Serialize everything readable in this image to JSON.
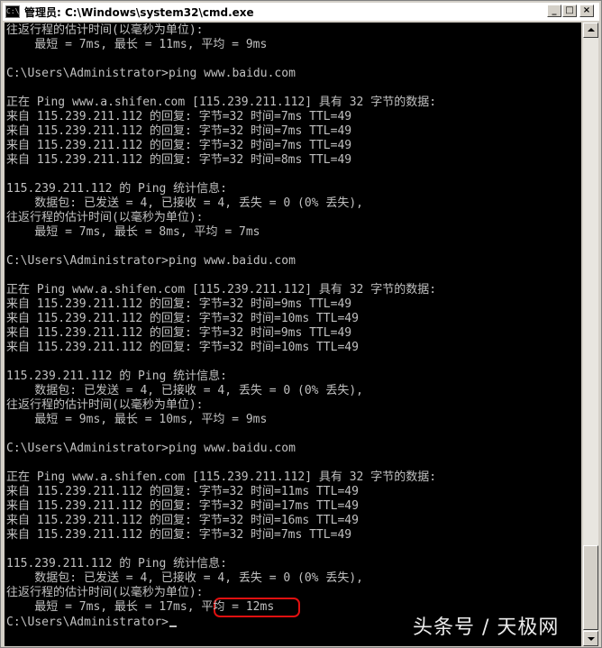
{
  "window": {
    "title": "管理员: C:\\Windows\\system32\\cmd.exe",
    "icon_label": "C:\\",
    "buttons": {
      "minimize": "_",
      "maximize": "□",
      "close": "×"
    }
  },
  "console": {
    "lines": [
      "往返行程的估计时间(以毫秒为单位):",
      "    最短 = 7ms, 最长 = 11ms, 平均 = 9ms",
      "",
      "C:\\Users\\Administrator>ping www.baidu.com",
      "",
      "正在 Ping www.a.shifen.com [115.239.211.112] 具有 32 字节的数据:",
      "来自 115.239.211.112 的回复: 字节=32 时间=7ms TTL=49",
      "来自 115.239.211.112 的回复: 字节=32 时间=7ms TTL=49",
      "来自 115.239.211.112 的回复: 字节=32 时间=7ms TTL=49",
      "来自 115.239.211.112 的回复: 字节=32 时间=8ms TTL=49",
      "",
      "115.239.211.112 的 Ping 统计信息:",
      "    数据包: 已发送 = 4, 已接收 = 4, 丢失 = 0 (0% 丢失),",
      "往返行程的估计时间(以毫秒为单位):",
      "    最短 = 7ms, 最长 = 8ms, 平均 = 7ms",
      "",
      "C:\\Users\\Administrator>ping www.baidu.com",
      "",
      "正在 Ping www.a.shifen.com [115.239.211.112] 具有 32 字节的数据:",
      "来自 115.239.211.112 的回复: 字节=32 时间=9ms TTL=49",
      "来自 115.239.211.112 的回复: 字节=32 时间=10ms TTL=49",
      "来自 115.239.211.112 的回复: 字节=32 时间=9ms TTL=49",
      "来自 115.239.211.112 的回复: 字节=32 时间=10ms TTL=49",
      "",
      "115.239.211.112 的 Ping 统计信息:",
      "    数据包: 已发送 = 4, 已接收 = 4, 丢失 = 0 (0% 丢失),",
      "往返行程的估计时间(以毫秒为单位):",
      "    最短 = 9ms, 最长 = 10ms, 平均 = 9ms",
      "",
      "C:\\Users\\Administrator>ping www.baidu.com",
      "",
      "正在 Ping www.a.shifen.com [115.239.211.112] 具有 32 字节的数据:",
      "来自 115.239.211.112 的回复: 字节=32 时间=11ms TTL=49",
      "来自 115.239.211.112 的回复: 字节=32 时间=17ms TTL=49",
      "来自 115.239.211.112 的回复: 字节=32 时间=16ms TTL=49",
      "来自 115.239.211.112 的回复: 字节=32 时间=7ms TTL=49",
      "",
      "115.239.211.112 的 Ping 统计信息:",
      "    数据包: 已发送 = 4, 已接收 = 4, 丢失 = 0 (0% 丢失),",
      "往返行程的估计时间(以毫秒为单位):",
      "    最短 = 7ms, 最长 = 17ms, 平均 = 12ms"
    ],
    "prompt": "C:\\Users\\Administrator>"
  },
  "watermark": "头条号 / 天极网",
  "colors": {
    "console_bg": "#000000",
    "console_text": "#c0c0c0",
    "highlight": "#e01010"
  }
}
